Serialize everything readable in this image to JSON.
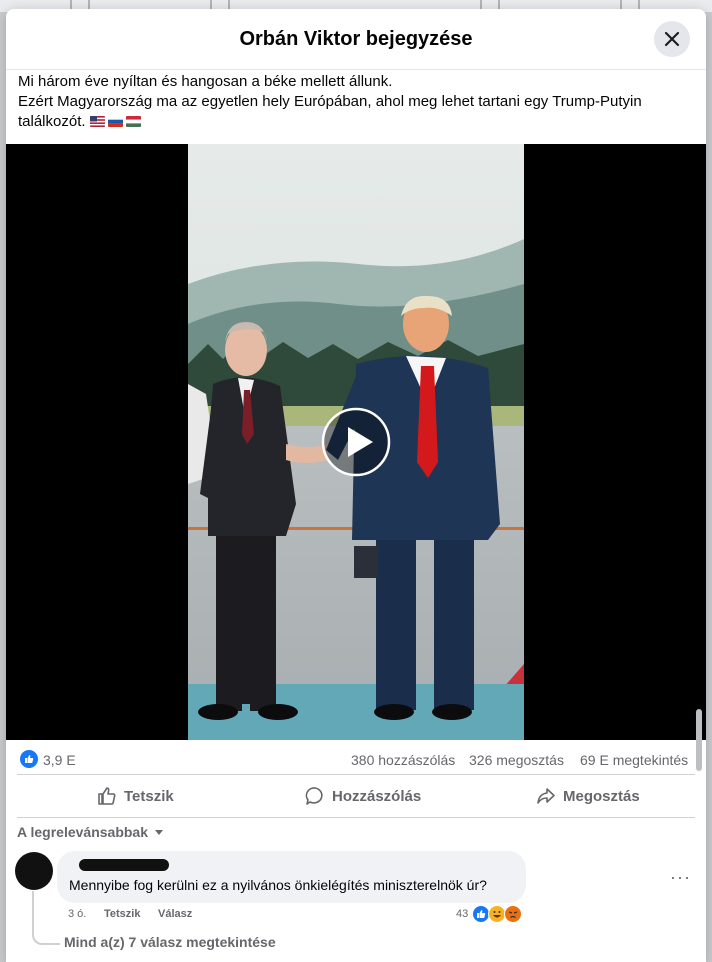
{
  "dialog": {
    "title": "Orbán Viktor bejegyzése"
  },
  "post": {
    "line1": "Mi három éve nyíltan és hangosan a béke mellett állunk.",
    "line2": "Ezért Magyarország ma az egyetlen hely Európában, ahol meg lehet tartani egy Trump-Putyin",
    "line3": "találkozót.",
    "flags": [
      "us-flag",
      "ru-flag",
      "hu-flag"
    ]
  },
  "video": {
    "play_icon": "play-icon"
  },
  "stats": {
    "reactions": "3,9 E",
    "comments": "380 hozzászólás",
    "shares": "326 megosztás",
    "views": "69 E megtekintés"
  },
  "actions": {
    "like": "Tetszik",
    "comment": "Hozzászólás",
    "share": "Megosztás"
  },
  "sort": {
    "label": "A legrelevánsabbak"
  },
  "comment": {
    "text": "Mennyibe fog kerülni ez a nyilvános önkielégítés miniszterelnök úr?",
    "time": "3 ó.",
    "like": "Tetszik",
    "reply": "Válasz",
    "reaction_count": "43",
    "more": "···"
  },
  "replies": {
    "label": "Mind a(z) 7 válasz megtekintése"
  },
  "colors": {
    "accent": "#1877f2",
    "text": "#050505",
    "muted": "#65676b",
    "tie_red": "#d3191c"
  }
}
